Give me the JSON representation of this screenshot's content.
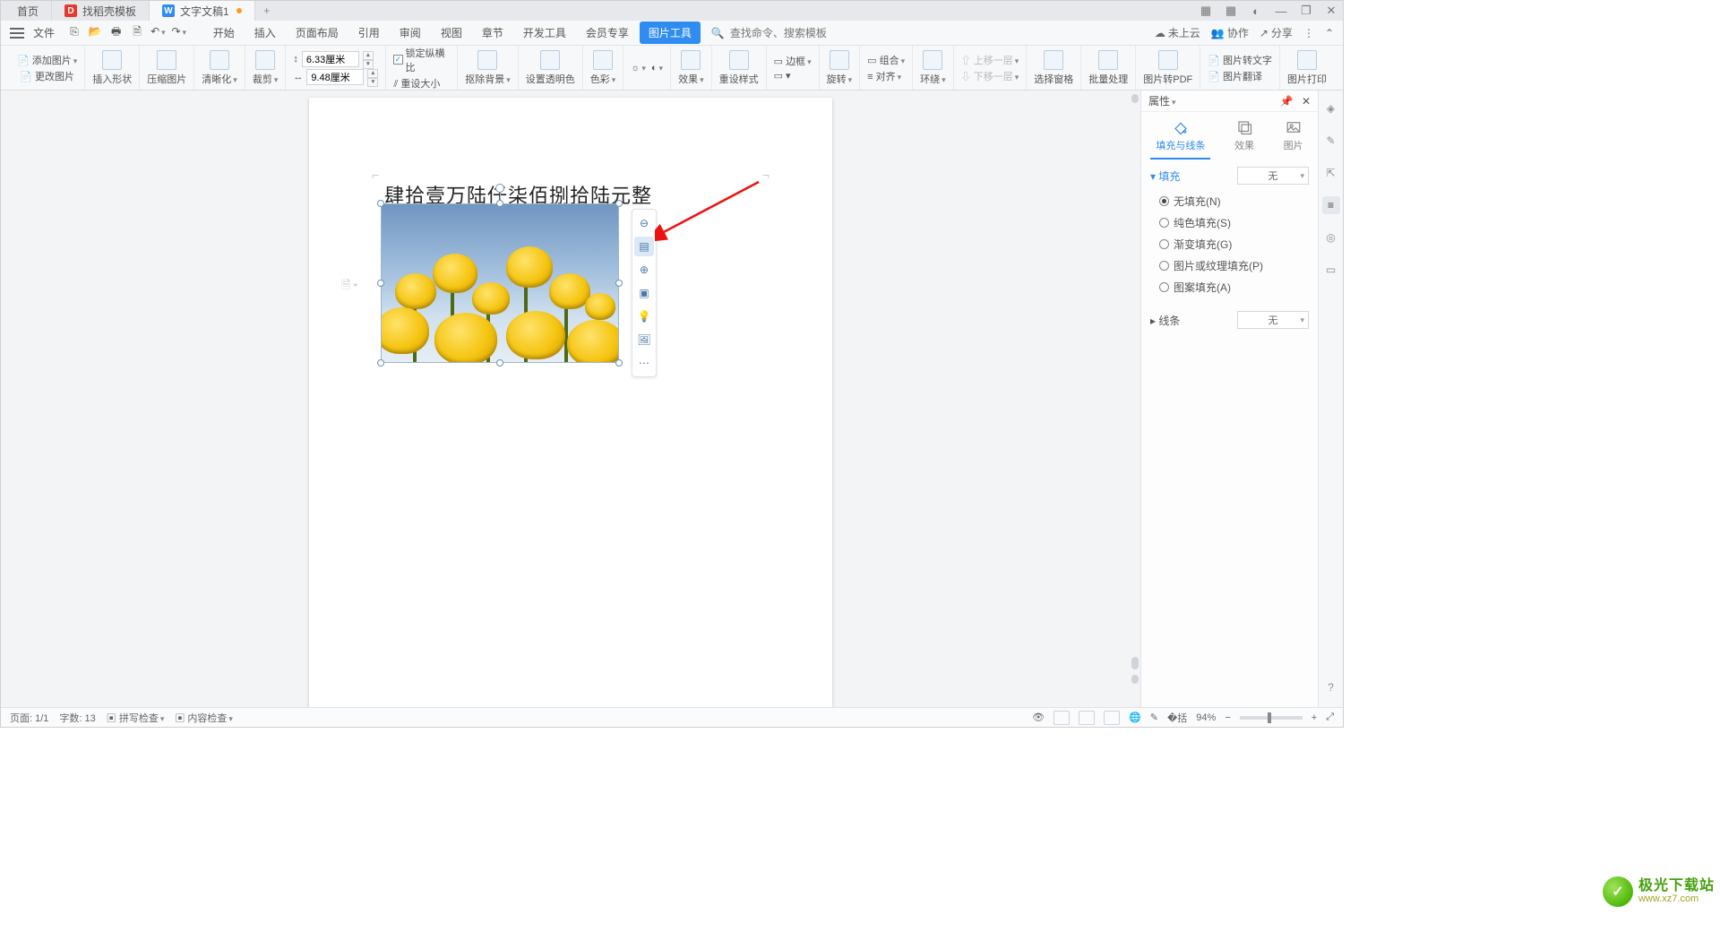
{
  "tabs": {
    "home": "首页",
    "tpl": "找稻壳模板",
    "doc": "文字文稿1",
    "plus": "+"
  },
  "title_ctrl": {
    "grid": "▦",
    "apps": "▦",
    "user": "◐",
    "min": "—",
    "max": "❐",
    "close": "✕"
  },
  "file_label": "文件",
  "qat": {
    "new": "⎘",
    "open": "📂",
    "print": "🖶",
    "previewprint": "🗎",
    "undo": "↶",
    "redo": "↷"
  },
  "menus": [
    "开始",
    "插入",
    "页面布局",
    "引用",
    "审阅",
    "视图",
    "章节",
    "开发工具",
    "会员专享",
    "图片工具"
  ],
  "active_menu": "图片工具",
  "search": {
    "icon": "🔍",
    "placeholder": "查找命令、搜索模板"
  },
  "menu_right": {
    "cloud": "未上云",
    "coop": "协作",
    "share": "分享"
  },
  "ribbon": {
    "add_img": "添加图片",
    "change_img": "更改图片",
    "insert_shape": "插入形状",
    "compress": "压缩图片",
    "sharpen": "清晰化",
    "crop": "裁剪",
    "h_lbl": "↕",
    "h_val": "6.33厘米",
    "w_lbl": "↔",
    "w_val": "9.48厘米",
    "lock": "锁定纵横比",
    "reset": "重设大小",
    "removebg": "抠除背景",
    "transparent": "设置透明色",
    "colormore": "色彩",
    "brightness": "☼",
    "contrast": "◐",
    "effect": "效果",
    "resetstyle": "重设样式",
    "border": "边框",
    "rotate": "旋转",
    "combine": "组合",
    "align": "对齐",
    "wrap": "环绕",
    "moveup": "上移一层",
    "movedown": "下移一层",
    "selpane": "选择窗格",
    "batch": "批量处理",
    "topdf": "图片转PDF",
    "totext": "图片转文字",
    "translate": "图片翻译",
    "print": "图片打印"
  },
  "doc_text": "肆拾壹万陆仟柒佰捌拾陆元整",
  "minitb": {
    "a": "⊖",
    "b": "▤",
    "c": "⊕",
    "d": "▣",
    "e": "💡",
    "f": "🖼",
    "g": "⋯"
  },
  "panel": {
    "title": "属性",
    "pin": "📌",
    "close": "✕",
    "tabs": {
      "fillline": "填充与线条",
      "effect": "效果",
      "image": "图片"
    },
    "fill_hdr": "填充",
    "fill_sel": "无",
    "opts": {
      "none": "无填充(N)",
      "solid": "纯色填充(S)",
      "grad": "渐变填充(G)",
      "pic": "图片或纹理填充(P)",
      "pattern": "图案填充(A)"
    },
    "line_hdr": "线条",
    "line_sel": "无"
  },
  "sidestrip": [
    "◈",
    "✎",
    "⇱",
    "≡",
    "◎",
    "▭",
    "?"
  ],
  "status": {
    "page": "页面: 1/1",
    "words": "字数: 13",
    "spell": "拼写检查",
    "content": "内容检查",
    "zoom": "94%"
  },
  "watermark": {
    "t1": "极光下载站",
    "t2": "www.xz7.com"
  }
}
